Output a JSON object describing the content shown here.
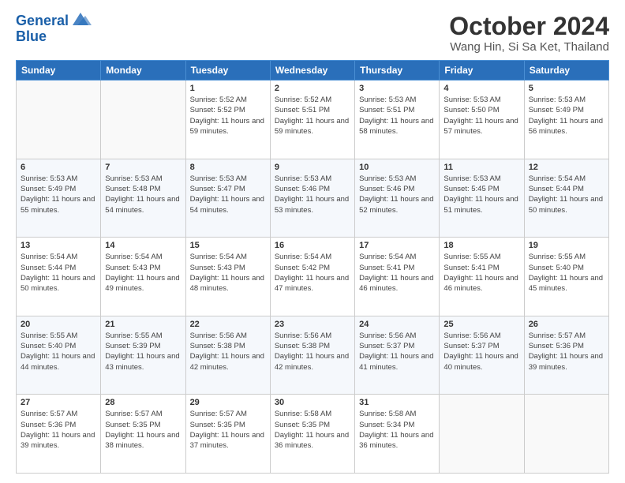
{
  "header": {
    "logo_line1": "General",
    "logo_line2": "Blue",
    "month_title": "October 2024",
    "location": "Wang Hin, Si Sa Ket, Thailand"
  },
  "days_of_week": [
    "Sunday",
    "Monday",
    "Tuesday",
    "Wednesday",
    "Thursday",
    "Friday",
    "Saturday"
  ],
  "weeks": [
    [
      {
        "day": "",
        "sunrise": "",
        "sunset": "",
        "daylight": ""
      },
      {
        "day": "",
        "sunrise": "",
        "sunset": "",
        "daylight": ""
      },
      {
        "day": "1",
        "sunrise": "Sunrise: 5:52 AM",
        "sunset": "Sunset: 5:52 PM",
        "daylight": "Daylight: 11 hours and 59 minutes."
      },
      {
        "day": "2",
        "sunrise": "Sunrise: 5:52 AM",
        "sunset": "Sunset: 5:51 PM",
        "daylight": "Daylight: 11 hours and 59 minutes."
      },
      {
        "day": "3",
        "sunrise": "Sunrise: 5:53 AM",
        "sunset": "Sunset: 5:51 PM",
        "daylight": "Daylight: 11 hours and 58 minutes."
      },
      {
        "day": "4",
        "sunrise": "Sunrise: 5:53 AM",
        "sunset": "Sunset: 5:50 PM",
        "daylight": "Daylight: 11 hours and 57 minutes."
      },
      {
        "day": "5",
        "sunrise": "Sunrise: 5:53 AM",
        "sunset": "Sunset: 5:49 PM",
        "daylight": "Daylight: 11 hours and 56 minutes."
      }
    ],
    [
      {
        "day": "6",
        "sunrise": "Sunrise: 5:53 AM",
        "sunset": "Sunset: 5:49 PM",
        "daylight": "Daylight: 11 hours and 55 minutes."
      },
      {
        "day": "7",
        "sunrise": "Sunrise: 5:53 AM",
        "sunset": "Sunset: 5:48 PM",
        "daylight": "Daylight: 11 hours and 54 minutes."
      },
      {
        "day": "8",
        "sunrise": "Sunrise: 5:53 AM",
        "sunset": "Sunset: 5:47 PM",
        "daylight": "Daylight: 11 hours and 54 minutes."
      },
      {
        "day": "9",
        "sunrise": "Sunrise: 5:53 AM",
        "sunset": "Sunset: 5:46 PM",
        "daylight": "Daylight: 11 hours and 53 minutes."
      },
      {
        "day": "10",
        "sunrise": "Sunrise: 5:53 AM",
        "sunset": "Sunset: 5:46 PM",
        "daylight": "Daylight: 11 hours and 52 minutes."
      },
      {
        "day": "11",
        "sunrise": "Sunrise: 5:53 AM",
        "sunset": "Sunset: 5:45 PM",
        "daylight": "Daylight: 11 hours and 51 minutes."
      },
      {
        "day": "12",
        "sunrise": "Sunrise: 5:54 AM",
        "sunset": "Sunset: 5:44 PM",
        "daylight": "Daylight: 11 hours and 50 minutes."
      }
    ],
    [
      {
        "day": "13",
        "sunrise": "Sunrise: 5:54 AM",
        "sunset": "Sunset: 5:44 PM",
        "daylight": "Daylight: 11 hours and 50 minutes."
      },
      {
        "day": "14",
        "sunrise": "Sunrise: 5:54 AM",
        "sunset": "Sunset: 5:43 PM",
        "daylight": "Daylight: 11 hours and 49 minutes."
      },
      {
        "day": "15",
        "sunrise": "Sunrise: 5:54 AM",
        "sunset": "Sunset: 5:43 PM",
        "daylight": "Daylight: 11 hours and 48 minutes."
      },
      {
        "day": "16",
        "sunrise": "Sunrise: 5:54 AM",
        "sunset": "Sunset: 5:42 PM",
        "daylight": "Daylight: 11 hours and 47 minutes."
      },
      {
        "day": "17",
        "sunrise": "Sunrise: 5:54 AM",
        "sunset": "Sunset: 5:41 PM",
        "daylight": "Daylight: 11 hours and 46 minutes."
      },
      {
        "day": "18",
        "sunrise": "Sunrise: 5:55 AM",
        "sunset": "Sunset: 5:41 PM",
        "daylight": "Daylight: 11 hours and 46 minutes."
      },
      {
        "day": "19",
        "sunrise": "Sunrise: 5:55 AM",
        "sunset": "Sunset: 5:40 PM",
        "daylight": "Daylight: 11 hours and 45 minutes."
      }
    ],
    [
      {
        "day": "20",
        "sunrise": "Sunrise: 5:55 AM",
        "sunset": "Sunset: 5:40 PM",
        "daylight": "Daylight: 11 hours and 44 minutes."
      },
      {
        "day": "21",
        "sunrise": "Sunrise: 5:55 AM",
        "sunset": "Sunset: 5:39 PM",
        "daylight": "Daylight: 11 hours and 43 minutes."
      },
      {
        "day": "22",
        "sunrise": "Sunrise: 5:56 AM",
        "sunset": "Sunset: 5:38 PM",
        "daylight": "Daylight: 11 hours and 42 minutes."
      },
      {
        "day": "23",
        "sunrise": "Sunrise: 5:56 AM",
        "sunset": "Sunset: 5:38 PM",
        "daylight": "Daylight: 11 hours and 42 minutes."
      },
      {
        "day": "24",
        "sunrise": "Sunrise: 5:56 AM",
        "sunset": "Sunset: 5:37 PM",
        "daylight": "Daylight: 11 hours and 41 minutes."
      },
      {
        "day": "25",
        "sunrise": "Sunrise: 5:56 AM",
        "sunset": "Sunset: 5:37 PM",
        "daylight": "Daylight: 11 hours and 40 minutes."
      },
      {
        "day": "26",
        "sunrise": "Sunrise: 5:57 AM",
        "sunset": "Sunset: 5:36 PM",
        "daylight": "Daylight: 11 hours and 39 minutes."
      }
    ],
    [
      {
        "day": "27",
        "sunrise": "Sunrise: 5:57 AM",
        "sunset": "Sunset: 5:36 PM",
        "daylight": "Daylight: 11 hours and 39 minutes."
      },
      {
        "day": "28",
        "sunrise": "Sunrise: 5:57 AM",
        "sunset": "Sunset: 5:35 PM",
        "daylight": "Daylight: 11 hours and 38 minutes."
      },
      {
        "day": "29",
        "sunrise": "Sunrise: 5:57 AM",
        "sunset": "Sunset: 5:35 PM",
        "daylight": "Daylight: 11 hours and 37 minutes."
      },
      {
        "day": "30",
        "sunrise": "Sunrise: 5:58 AM",
        "sunset": "Sunset: 5:35 PM",
        "daylight": "Daylight: 11 hours and 36 minutes."
      },
      {
        "day": "31",
        "sunrise": "Sunrise: 5:58 AM",
        "sunset": "Sunset: 5:34 PM",
        "daylight": "Daylight: 11 hours and 36 minutes."
      },
      {
        "day": "",
        "sunrise": "",
        "sunset": "",
        "daylight": ""
      },
      {
        "day": "",
        "sunrise": "",
        "sunset": "",
        "daylight": ""
      }
    ]
  ]
}
